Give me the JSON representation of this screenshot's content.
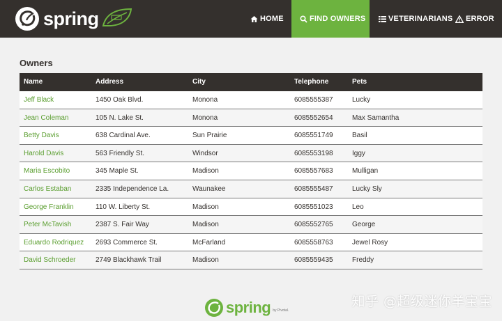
{
  "brand": {
    "name": "spring"
  },
  "nav": {
    "items": [
      {
        "label": "HOME",
        "icon": "home-icon",
        "active": false
      },
      {
        "label": "FIND OWNERS",
        "icon": "search-icon",
        "active": true
      },
      {
        "label": "VETERINARIANS",
        "icon": "list-icon",
        "active": false
      },
      {
        "label": "ERROR",
        "icon": "warning-icon",
        "active": false
      }
    ]
  },
  "page": {
    "title": "Owners"
  },
  "table": {
    "headers": [
      "Name",
      "Address",
      "City",
      "Telephone",
      "Pets"
    ],
    "rows": [
      {
        "name": "Jeff Black",
        "address": "1450 Oak Blvd.",
        "city": "Monona",
        "telephone": "6085555387",
        "pets": "Lucky"
      },
      {
        "name": "Jean Coleman",
        "address": "105 N. Lake St.",
        "city": "Monona",
        "telephone": "6085552654",
        "pets": "Max Samantha"
      },
      {
        "name": "Betty Davis",
        "address": "638 Cardinal Ave.",
        "city": "Sun Prairie",
        "telephone": "6085551749",
        "pets": "Basil"
      },
      {
        "name": "Harold Davis",
        "address": "563 Friendly St.",
        "city": "Windsor",
        "telephone": "6085553198",
        "pets": "Iggy"
      },
      {
        "name": "Maria Escobito",
        "address": "345 Maple St.",
        "city": "Madison",
        "telephone": "6085557683",
        "pets": "Mulligan"
      },
      {
        "name": "Carlos Estaban",
        "address": "2335 Independence La.",
        "city": "Waunakee",
        "telephone": "6085555487",
        "pets": "Lucky Sly"
      },
      {
        "name": "George Franklin",
        "address": "110 W. Liberty St.",
        "city": "Madison",
        "telephone": "6085551023",
        "pets": "Leo"
      },
      {
        "name": "Peter McTavish",
        "address": "2387 S. Fair Way",
        "city": "Madison",
        "telephone": "6085552765",
        "pets": "George"
      },
      {
        "name": "Eduardo Rodriquez",
        "address": "2693 Commerce St.",
        "city": "McFarland",
        "telephone": "6085558763",
        "pets": "Jewel Rosy"
      },
      {
        "name": "David Schroeder",
        "address": "2749 Blackhawk Trail",
        "city": "Madison",
        "telephone": "6085559435",
        "pets": "Freddy"
      }
    ]
  },
  "footer": {
    "logo_text": "spring",
    "by_text": "by Pivotal."
  },
  "watermark": "知乎 @超级迷你羊宝宝",
  "colors": {
    "navbar": "#34302d",
    "accent": "#6db33f",
    "link": "#5a9e2f",
    "background": "#f1f1f1"
  }
}
